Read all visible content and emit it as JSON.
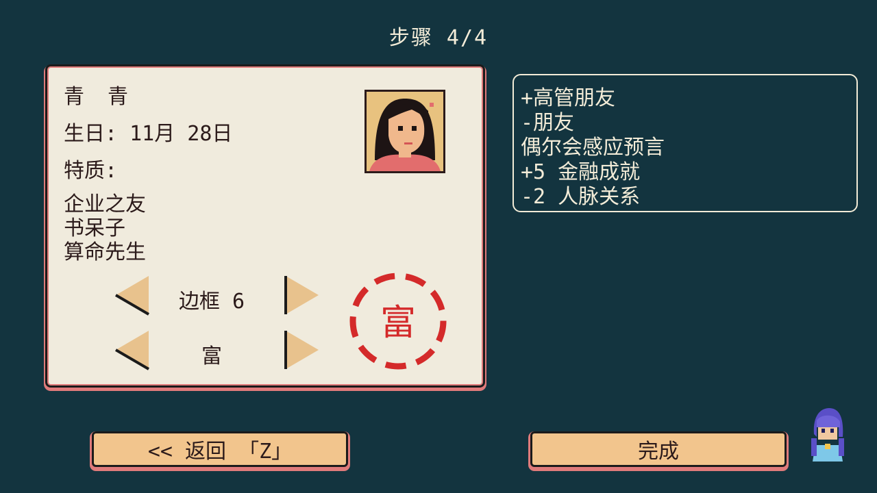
{
  "header": {
    "step_label": "步骤 4/4"
  },
  "character": {
    "name": "青 青",
    "birthday": "生日: 11月 28日",
    "traits_label": "特质:",
    "traits": [
      "企业之友",
      "书呆子",
      "算命先生"
    ]
  },
  "selectors": {
    "frame_label": "边框 6",
    "stamp_label": "富"
  },
  "stamp": {
    "text": "富",
    "color": "#d42a2a"
  },
  "effects": [
    "+高管朋友",
    "-朋友",
    "偶尔会感应预言",
    "+5 金融成就",
    "-2 人脉关系"
  ],
  "buttons": {
    "back_label": "<< 返回 「Z」",
    "done_label": "完成"
  },
  "colors": {
    "background": "#13343f",
    "card": "#f0ebdd",
    "button": "#f2c58d",
    "accent": "#e07b7b",
    "stamp": "#d42a2a"
  }
}
